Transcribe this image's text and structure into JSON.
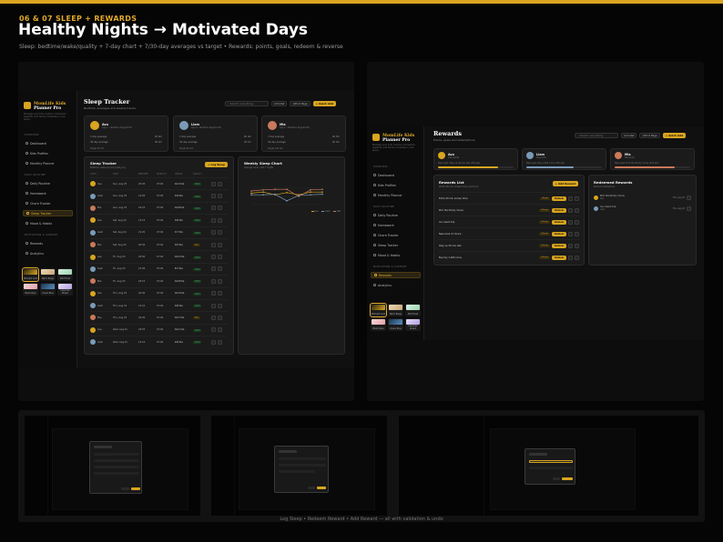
{
  "header": {
    "kicker": "06 & 07  SLEEP + REWARDS",
    "title": "Healthy Nights → Motivated Days",
    "subtitle": "Sleep: bedtime/wake/quality + 7-day chart + 7/30-day averages vs target • Rewards: points, goals, redeem & reverse"
  },
  "app": {
    "brand_a": "MomLife",
    "brand_b": "Kids",
    "brand_c": "Planner Pro",
    "sidebar_desc": "Manage your kids routine, homework, rewards, and family schedule in one place.",
    "nav_sections": [
      "OVERVIEW",
      "DAILY ROUTINE",
      "MOTIVATION & SUPPORT"
    ],
    "nav": [
      "Dashboard",
      "Kids Profiles",
      "Monthly Planner",
      "Daily Routine",
      "Homework",
      "Chore Tracker",
      "Sleep Tracker",
      "Mood & Habits",
      "Rewards",
      "Analytics"
    ],
    "themes": [
      "Midnight Gold",
      "Warm Beige",
      "Mint Fresh",
      "Blush Rose",
      "Ocean Blue",
      "Lavender Dream"
    ],
    "search_placeholder": "Search everything",
    "kid_select": "All kids",
    "print_label": "Print Page",
    "quick_add": "+ Quick Add"
  },
  "sleep": {
    "title": "Sleep Tracker",
    "subtitle": "Bedtime, averages and weekly trends.",
    "kids": [
      {
        "name": "Ava",
        "meta": "Age 7 • Bedtime target 8:30",
        "r1": [
          "7-day average",
          "9h 6m"
        ],
        "r2": [
          "30-day average",
          "9h 2m"
        ],
        "foot": "Target 9h 0m",
        "color": "#d9a520"
      },
      {
        "name": "Liam",
        "meta": "Age 9 • Bedtime target 9:00",
        "r1": [
          "7-day average",
          "9h 4m"
        ],
        "r2": [
          "30-day average",
          "9h 1m"
        ],
        "foot": "Target 9h 0m",
        "color": "#7a9bb8"
      },
      {
        "name": "Mia",
        "meta": "Age 5 • Bedtime target 8:00",
        "r1": [
          "7-day average",
          "9h 5m"
        ],
        "r2": [
          "30-day average",
          "9h 0m"
        ],
        "foot": "Target 10h 0m",
        "color": "#c97a5a"
      }
    ],
    "table_title": "Sleep Tracker",
    "table_sub": "Bedtime, wake-up and quality log",
    "log_btn": "+ Log Sleep",
    "cols": [
      "CHILD",
      "DATE",
      "BEDTIME",
      "WAKE UP",
      "HOURS",
      "QUALITY",
      ""
    ],
    "rows": [
      [
        "Ava",
        "Sun, Aug 25",
        "20:45",
        "07:00",
        "10.3 hrs",
        "Good"
      ],
      [
        "Liam",
        "Sun, Aug 25",
        "21:05",
        "07:00",
        "9.9 hrs",
        "Good"
      ],
      [
        "Mia",
        "Sun, Aug 25",
        "20:10",
        "07:00",
        "10.8 hrs",
        "Good"
      ],
      [
        "Ava",
        "Sat, Aug 24",
        "21:15",
        "07:00",
        "9.8 hrs",
        "Good"
      ],
      [
        "Liam",
        "Sat, Aug 24",
        "21:20",
        "07:00",
        "9.7 hrs",
        "Good"
      ],
      [
        "Mia",
        "Sat, Aug 24",
        "20:30",
        "07:00",
        "9.5 hrs",
        "Fair"
      ],
      [
        "Ava",
        "Fri, Aug 23",
        "20:50",
        "07:00",
        "10.2 hrs",
        "Good"
      ],
      [
        "Liam",
        "Fri, Aug 23",
        "21:30",
        "07:00",
        "8.7 hrs",
        "Good"
      ],
      [
        "Mia",
        "Fri, Aug 23",
        "20:15",
        "07:00",
        "10.8 hrs",
        "Good"
      ],
      [
        "Ava",
        "Thu, Aug 22",
        "20:40",
        "07:00",
        "10.3 hrs",
        "Good"
      ],
      [
        "Liam",
        "Thu, Aug 22",
        "21:10",
        "07:00",
        "9.8 hrs",
        "Good"
      ],
      [
        "Mia",
        "Thu, Aug 22",
        "20:20",
        "07:00",
        "10.7 hrs",
        "Fair"
      ],
      [
        "Ava",
        "Wed, Aug 21",
        "20:55",
        "07:00",
        "10.1 hrs",
        "Good"
      ],
      [
        "Liam",
        "Wed, Aug 21",
        "21:15",
        "07:00",
        "9.8 hrs",
        "Good"
      ]
    ],
    "chart_title": "Weekly Sleep Chart",
    "chart_sub": "Average hours, last 7 nights",
    "chart_legend": [
      "Ava",
      "Liam",
      "Mia"
    ]
  },
  "rewards": {
    "title": "Rewards",
    "subtitle": "Points, goals and redemptions.",
    "kids": [
      {
        "name": "Ava",
        "meta": "120 points",
        "goal": "Next goal: Stay up 30 min late (150 pts)",
        "color": "#d9a520"
      },
      {
        "name": "Liam",
        "meta": "95 points",
        "goal": "Next goal: Buy 1,000 coins (150 pts)",
        "color": "#7a9bb8"
      },
      {
        "name": "Mia",
        "meta": "80 points",
        "goal": "Next goal: Pick the family movie (100 pts)",
        "color": "#c97a5a"
      }
    ],
    "list_title": "Rewards List",
    "list_sub": "What kids can redeem their points for",
    "add_btn": "+ Add Reward",
    "items": [
      [
        "Extra 30 min screen time",
        "60 pts"
      ],
      [
        "Pick the family movie",
        "100 pts"
      ],
      [
        "Ice cream trip",
        "120 pts"
      ],
      [
        "New book of choice",
        "150 pts"
      ],
      [
        "Stay up 30 min late",
        "150 pts"
      ],
      [
        "Buy toy 1,000 coins",
        "200 pts"
      ]
    ],
    "redeem_label": "Redeem",
    "redeemed_title": "Redeemed Rewards",
    "redeemed_sub": "Recent redemptions",
    "redeemed": [
      [
        "Pick the family movie",
        "Ava",
        "Thu, Aug 22"
      ],
      [
        "Ice cream trip",
        "Liam",
        "Thu, Aug 22"
      ]
    ]
  },
  "caption": "Log Sleep • Redeem Reward • Add Reward — all with validation & undo"
}
